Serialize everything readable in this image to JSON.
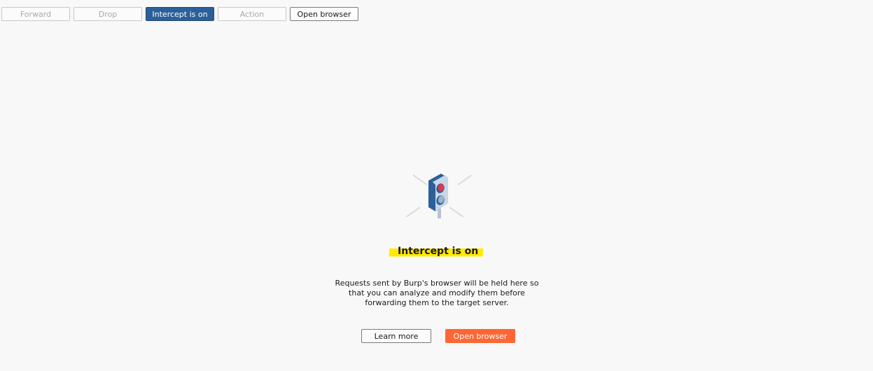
{
  "toolbar": {
    "forward_label": "Forward",
    "drop_label": "Drop",
    "intercept_label": "Intercept is on",
    "action_label": "Action",
    "open_browser_label": "Open browser"
  },
  "empty_state": {
    "icon": "traffic-light-icon",
    "title": "Intercept is on",
    "description": "Requests sent by Burp's browser will be held here so that you can analyze and modify them before forwarding them to the target server.",
    "learn_more_label": "Learn more",
    "open_browser_label": "Open browser"
  },
  "colors": {
    "intercept_active": "#2b6099",
    "primary_button": "#ff6633",
    "title_highlight": "#ffea00",
    "background": "#f8f8f8"
  }
}
